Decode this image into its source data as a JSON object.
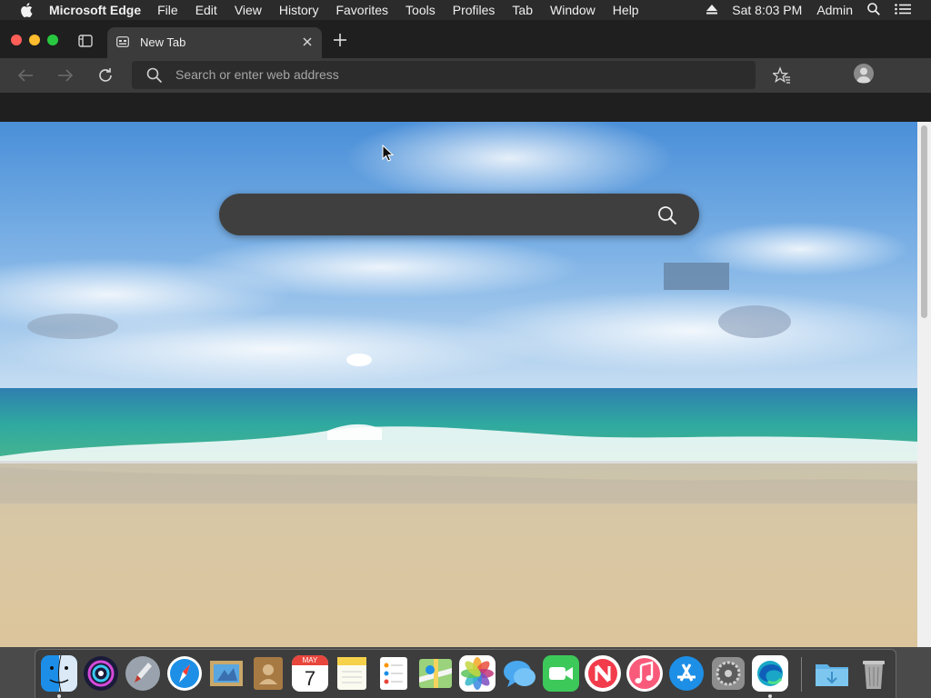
{
  "menubar": {
    "app_name": "Microsoft Edge",
    "menus": [
      "File",
      "Edit",
      "View",
      "History",
      "Favorites",
      "Tools",
      "Profiles",
      "Tab",
      "Window",
      "Help"
    ],
    "clock": "Sat 8:03 PM",
    "user": "Admin",
    "icons": [
      "apple-icon",
      "eject-icon",
      "spotlight-icon",
      "control-center-icon"
    ]
  },
  "browser": {
    "tab": {
      "title": "New Tab"
    },
    "address_bar": {
      "placeholder": "Search or enter web address",
      "value": ""
    }
  },
  "page": {
    "search_placeholder": "",
    "background": "beach-sea-sky"
  },
  "dock": {
    "apps": [
      "Finder",
      "Siri",
      "Launchpad",
      "Safari",
      "Mail",
      "Contacts",
      "Calendar",
      "Notes",
      "Reminders",
      "Maps",
      "Photos",
      "Messages",
      "FaceTime",
      "News",
      "Music",
      "App Store",
      "System Preferences",
      "Microsoft Edge",
      "Downloads",
      "Trash"
    ],
    "calendar_month": "MAY",
    "calendar_day": "7"
  },
  "colors": {
    "menubar_bg": "#2b2b2b",
    "toolbar_bg": "#3b3b3b",
    "address_bg": "#2c2c2c",
    "traffic_red": "#ff5f57",
    "traffic_yellow": "#febc2e",
    "traffic_green": "#28c840"
  }
}
